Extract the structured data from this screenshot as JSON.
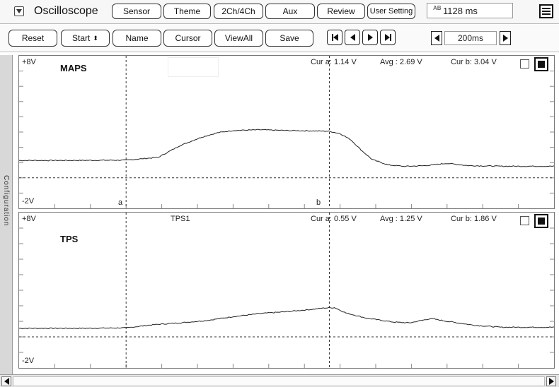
{
  "header": {
    "title": "Oscilloscope",
    "buttons": [
      "Sensor",
      "Theme",
      "2Ch/4Ch",
      "Aux",
      "Review",
      "User Setting"
    ],
    "ab_label": "AB",
    "time_value": "1128 ms"
  },
  "controls": {
    "buttons": [
      "Reset",
      "Start",
      "Name",
      "Cursor",
      "ViewAll",
      "Save"
    ],
    "start_arrows": "⬍",
    "time_div": "200ms"
  },
  "sidebar": {
    "label": "Configuration"
  },
  "channels": [
    {
      "name": "MAPS",
      "top_label": "+8V",
      "bottom_label": "-2V",
      "sensor_label": "",
      "cur_a": "Cur a: 1.14 V",
      "avg": "Avg  : 2.69 V",
      "cur_b": "Cur b: 3.04 V",
      "cursor_a_label": "a",
      "cursor_b_label": "b",
      "waveform_points": [
        [
          0,
          1.14
        ],
        [
          0.1,
          1.14
        ],
        [
          0.2,
          1.16
        ],
        [
          0.26,
          1.34
        ],
        [
          0.3,
          2.1
        ],
        [
          0.34,
          2.65
        ],
        [
          0.37,
          2.95
        ],
        [
          0.4,
          3.1
        ],
        [
          0.45,
          3.15
        ],
        [
          0.5,
          3.1
        ],
        [
          0.55,
          3.08
        ],
        [
          0.58,
          3.05
        ],
        [
          0.6,
          2.9
        ],
        [
          0.62,
          2.5
        ],
        [
          0.64,
          1.8
        ],
        [
          0.66,
          1.2
        ],
        [
          0.69,
          0.85
        ],
        [
          0.72,
          0.75
        ],
        [
          0.76,
          0.8
        ],
        [
          0.8,
          0.95
        ],
        [
          0.84,
          0.8
        ],
        [
          0.9,
          0.76
        ],
        [
          1,
          0.76
        ]
      ],
      "reference_level": 0.2
    },
    {
      "name": "TPS",
      "top_label": "+8V",
      "bottom_label": "-2V",
      "sensor_label": "TPS1",
      "cur_a": "Cur a: 0.55 V",
      "avg": "Avg  : 1.25 V",
      "cur_b": "Cur b: 1.86 V",
      "waveform_points": [
        [
          0,
          0.55
        ],
        [
          0.12,
          0.55
        ],
        [
          0.2,
          0.58
        ],
        [
          0.25,
          0.78
        ],
        [
          0.3,
          0.9
        ],
        [
          0.35,
          1.05
        ],
        [
          0.4,
          1.3
        ],
        [
          0.45,
          1.5
        ],
        [
          0.5,
          1.62
        ],
        [
          0.55,
          1.78
        ],
        [
          0.57,
          1.86
        ],
        [
          0.59,
          1.88
        ],
        [
          0.61,
          1.55
        ],
        [
          0.65,
          1.2
        ],
        [
          0.7,
          0.95
        ],
        [
          0.73,
          0.9
        ],
        [
          0.77,
          1.18
        ],
        [
          0.8,
          1.0
        ],
        [
          0.85,
          0.75
        ],
        [
          0.9,
          0.62
        ],
        [
          1,
          0.62
        ]
      ],
      "reference_level": 0.2
    }
  ],
  "cursor_positions": {
    "a": 0.2,
    "b": 0.58
  },
  "colors": {
    "trace": "#222222",
    "grid": "#888888"
  }
}
